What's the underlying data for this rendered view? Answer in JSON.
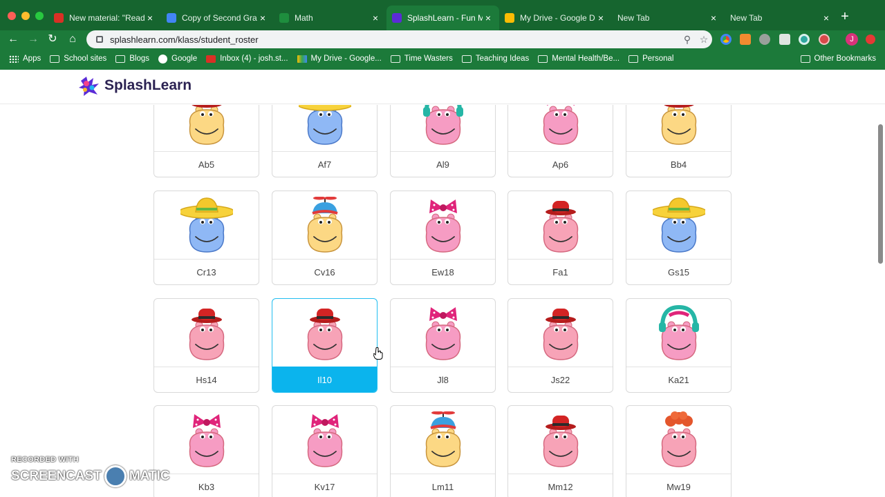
{
  "browser": {
    "tabs": [
      {
        "title": "New material: \"Read",
        "favicon": "gmail-icon",
        "color": "#d93025",
        "active": false
      },
      {
        "title": "Copy of Second Gra",
        "favicon": "docs-icon",
        "color": "#4285f4",
        "active": false
      },
      {
        "title": "Math",
        "favicon": "classroom-icon",
        "color": "#1e8e3e",
        "active": false
      },
      {
        "title": "SplashLearn - Fun M",
        "favicon": "splashlearn-icon",
        "color": "#5b2bd6",
        "active": true
      },
      {
        "title": "My Drive - Google D",
        "favicon": "drive-icon",
        "color": "#fbbc04",
        "active": false
      },
      {
        "title": "New Tab",
        "favicon": "",
        "color": "",
        "active": false
      },
      {
        "title": "New Tab",
        "favicon": "",
        "color": "",
        "active": false
      }
    ],
    "url": "splashlearn.com/klass/student_roster",
    "bookmarks": [
      {
        "label": "Apps",
        "icon": "apps-grid-icon"
      },
      {
        "label": "School sites",
        "icon": "folder-icon"
      },
      {
        "label": "Blogs",
        "icon": "folder-icon"
      },
      {
        "label": "Google",
        "icon": "google-icon"
      },
      {
        "label": "Inbox (4) - josh.st...",
        "icon": "gmail-icon"
      },
      {
        "label": "My Drive - Google...",
        "icon": "drive-icon"
      },
      {
        "label": "Time Wasters",
        "icon": "folder-icon"
      },
      {
        "label": "Teaching Ideas",
        "icon": "folder-icon"
      },
      {
        "label": "Mental Health/Be...",
        "icon": "folder-icon"
      },
      {
        "label": "Personal",
        "icon": "folder-icon"
      }
    ],
    "other_bookmarks": "Other Bookmarks",
    "profile_initial": "J"
  },
  "site": {
    "brand": "SplashLearn"
  },
  "students": [
    {
      "name": "Ab5",
      "face": "yellow",
      "hat": "redcap"
    },
    {
      "name": "Af7",
      "face": "blue",
      "hat": "sombrero"
    },
    {
      "name": "Al9",
      "face": "pink",
      "hat": "headphones"
    },
    {
      "name": "Ap6",
      "face": "pink",
      "hat": "bow"
    },
    {
      "name": "Bb4",
      "face": "yellow",
      "hat": "redcap"
    },
    {
      "name": "Cr13",
      "face": "blue",
      "hat": "sombrero"
    },
    {
      "name": "Cv16",
      "face": "yellow",
      "hat": "propeller"
    },
    {
      "name": "Ew18",
      "face": "pink",
      "hat": "bow"
    },
    {
      "name": "Fa1",
      "face": "pink",
      "hat": "redcap"
    },
    {
      "name": "Gs15",
      "face": "blue",
      "hat": "sombrero"
    },
    {
      "name": "Hs14",
      "face": "pink",
      "hat": "redcap"
    },
    {
      "name": "Il10",
      "face": "pink",
      "hat": "redcap",
      "selected": true
    },
    {
      "name": "Jl8",
      "face": "pink",
      "hat": "bow"
    },
    {
      "name": "Js22",
      "face": "pink",
      "hat": "redcap"
    },
    {
      "name": "Ka21",
      "face": "pink",
      "hat": "headphones"
    },
    {
      "name": "Kb3",
      "face": "pink",
      "hat": "bow"
    },
    {
      "name": "Kv17",
      "face": "pink",
      "hat": "bow"
    },
    {
      "name": "Lm11",
      "face": "yellow",
      "hat": "propeller"
    },
    {
      "name": "Mm12",
      "face": "pink",
      "hat": "redcap"
    },
    {
      "name": "Mw19",
      "face": "pink",
      "hat": "redhair"
    }
  ],
  "watermark": {
    "line1": "RECORDED WITH",
    "line2a": "SCREENCAST",
    "line2b": "MATIC"
  },
  "colors": {
    "chrome_green": "#1c7a3a",
    "selected_blue": "#0bb4ed"
  }
}
